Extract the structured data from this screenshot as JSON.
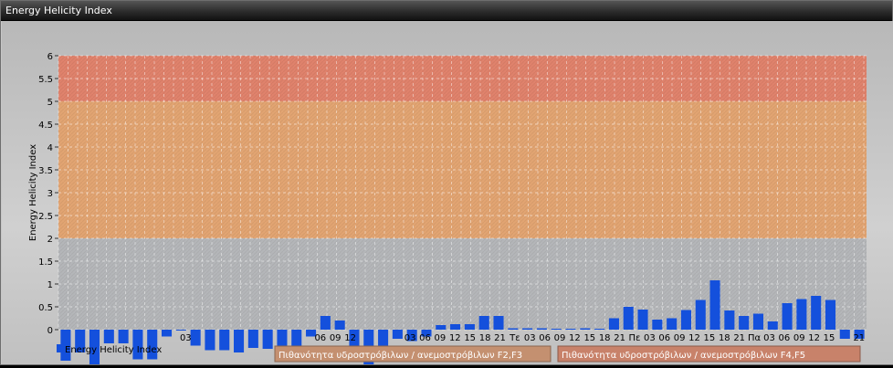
{
  "window": {
    "title": "Energy Helicity Index"
  },
  "legend": {
    "series_label": "Energy Helicity Index",
    "band_f2f3_label": "Πιθανότητα υδροστρόβιλων / ανεμοστρόβιλων F2,F3",
    "band_f4f5_label": "Πιθανότητα υδροστρόβιλων / ανεμοστρόβιλων F4,F5"
  },
  "colors": {
    "bar": "#1450dc",
    "band_f4f5": "#e0826c",
    "band_f2f3": "#e2a472",
    "gridline": "#ffffff",
    "legend_swatch_f2f3": "#c49070",
    "legend_swatch_f4f5": "#c8826a"
  },
  "chart_data": {
    "type": "bar",
    "ylabel": "Energy Helicity Index",
    "ylim": [
      0,
      6
    ],
    "yticks": [
      "0",
      "0.5",
      "1",
      "1.5",
      "2",
      "2.5",
      "3",
      "3.5",
      "4",
      "4.5",
      "5",
      "5.5",
      "6"
    ],
    "grid": true,
    "bands": [
      {
        "from": 2,
        "to": 5,
        "color": "#e2a472"
      },
      {
        "from": 5,
        "to": 6,
        "color": "#e0826c"
      }
    ],
    "x_tick_labels": [
      "",
      "",
      "",
      "",
      "",
      "",
      "",
      "",
      "03",
      "",
      "",
      "",
      "",
      "",
      "",
      "",
      "",
      "06",
      "09",
      "12",
      "",
      "",
      "",
      "03",
      "06",
      "09",
      "12",
      "15",
      "18",
      "21",
      "Τε",
      "03",
      "06",
      "09",
      "12",
      "15",
      "18",
      "21",
      "Πε",
      "03",
      "06",
      "09",
      "12",
      "15",
      "18",
      "21",
      "Πα",
      "03",
      "06",
      "09",
      "12",
      "15",
      "",
      "21"
    ],
    "values": [
      -0.68,
      -0.5,
      -0.8,
      -0.3,
      -0.3,
      -0.65,
      -0.65,
      -0.15,
      -0.02,
      -0.35,
      -0.45,
      -0.45,
      -0.5,
      -0.4,
      -0.42,
      -0.35,
      -0.4,
      -0.15,
      0.3,
      0.2,
      -0.65,
      -0.8,
      -0.5,
      -0.2,
      -0.25,
      -0.15,
      0.1,
      0.12,
      0.12,
      0.3,
      0.3,
      0.03,
      0.03,
      0.03,
      0.02,
      0.02,
      0.03,
      0.02,
      0.25,
      0.5,
      0.44,
      0.22,
      0.25,
      0.43,
      0.65,
      1.08,
      0.42,
      0.3,
      0.35,
      0.18,
      0.58,
      0.67,
      0.74,
      0.65,
      -0.2,
      -0.2
    ]
  }
}
